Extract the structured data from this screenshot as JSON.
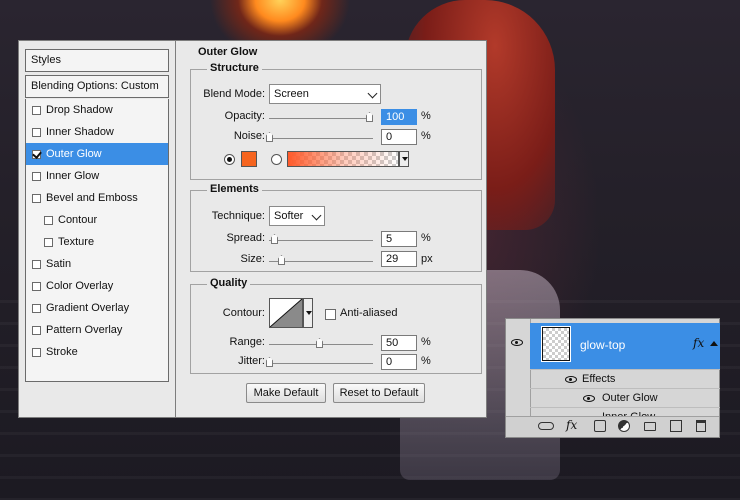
{
  "styles": {
    "header": "Styles",
    "blending_options": "Blending Options: Custom",
    "items": [
      {
        "label": "Drop Shadow",
        "checked": false
      },
      {
        "label": "Inner Shadow",
        "checked": false
      },
      {
        "label": "Outer Glow",
        "checked": true,
        "selected": true
      },
      {
        "label": "Inner Glow",
        "checked": false
      },
      {
        "label": "Bevel and Emboss",
        "checked": false
      },
      {
        "label": "Contour",
        "checked": false
      },
      {
        "label": "Texture",
        "checked": false
      },
      {
        "label": "Satin",
        "checked": false
      },
      {
        "label": "Color Overlay",
        "checked": false
      },
      {
        "label": "Gradient Overlay",
        "checked": false
      },
      {
        "label": "Pattern Overlay",
        "checked": false
      },
      {
        "label": "Stroke",
        "checked": false
      }
    ]
  },
  "outer_glow": {
    "title": "Outer Glow",
    "structure": {
      "title": "Structure",
      "blend_mode_label": "Blend Mode:",
      "blend_mode": "Screen",
      "opacity_label": "Opacity:",
      "opacity": "100",
      "opacity_level": 1.0,
      "noise_label": "Noise:",
      "noise": "0",
      "noise_level": 0.0,
      "unit_percent": "%",
      "glow_color": "#f5641e"
    },
    "elements": {
      "title": "Elements",
      "technique_label": "Technique:",
      "technique": "Softer",
      "spread_label": "Spread:",
      "spread": "5",
      "spread_level": 0.05,
      "size_label": "Size:",
      "size": "29",
      "size_level": 0.12,
      "unit_percent": "%",
      "unit_px": "px"
    },
    "quality": {
      "title": "Quality",
      "contour_label": "Contour:",
      "anti_aliased_label": "Anti-aliased",
      "range_label": "Range:",
      "range": "50",
      "range_level": 0.5,
      "jitter_label": "Jitter:",
      "jitter": "0",
      "jitter_level": 0.0,
      "unit_percent": "%"
    },
    "make_default": "Make Default",
    "reset_default": "Reset to Default"
  },
  "layers": {
    "layer_name": "glow-top",
    "fx_label": "fx",
    "effects_label": "Effects",
    "effect_outer_glow": "Outer Glow",
    "effect_inner_glow": "Inner Glow",
    "selected_color": "#3b8ee5"
  }
}
